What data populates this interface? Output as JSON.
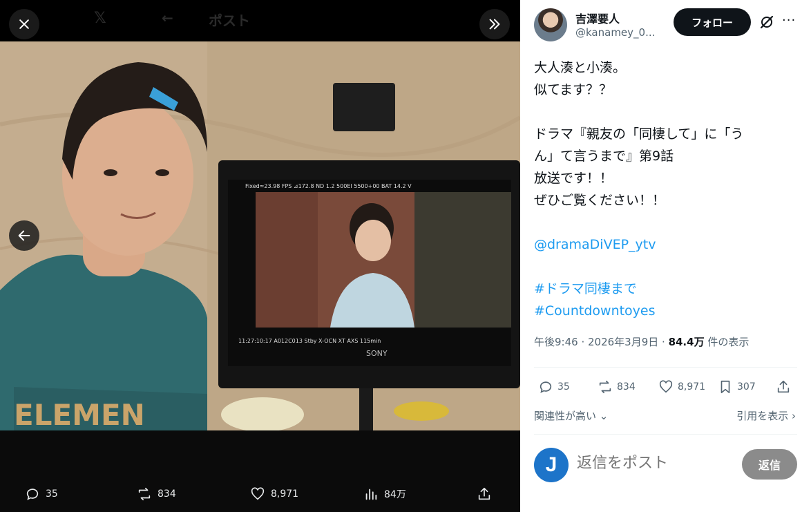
{
  "media": {
    "header_title": "ポスト",
    "actions": {
      "reply_count": "35",
      "repost_count": "834",
      "like_count": "8,971",
      "views_count": "84万"
    },
    "photo": {
      "monitor_brand": "SONY",
      "monitor_top": [
        "Fixed≈23.98 FPS",
        "⊿172.8",
        "ND 1.2",
        "500EI",
        "5500+00",
        "BAT 14.2 V"
      ],
      "monitor_bottom": [
        "11:27:10:17",
        "A012C013",
        "Stby",
        "X-OCN XT",
        "AXS 115min"
      ],
      "shirt_text": "ELEMEN"
    }
  },
  "author": {
    "name": "吉澤要人",
    "handle": "@kanamey_0..."
  },
  "buttons": {
    "follow": "フォロー",
    "reply": "返信"
  },
  "tweet": {
    "line1": "大人湊と小湊。",
    "line2": "似てます？？",
    "line3": "ドラマ『親友の「同棲して」に「う",
    "line4": "ん」て言うまで』第9話",
    "line5": "放送です！！",
    "line6": "ぜひご覧ください！！",
    "mention": "@dramaDiVEP_ytv",
    "hashtag1": "#ドラマ同棲まで",
    "hashtag2": "#Countdowntoyes"
  },
  "meta": {
    "time": "午後9:46 · 2026年3月9日 · ",
    "views": "84.4万",
    "views_suffix": " 件の表示"
  },
  "stats": {
    "replies": "35",
    "reposts": "834",
    "likes": "8,971",
    "bookmarks": "307"
  },
  "sort_label": "関連性が高い",
  "quote_label": "引用を表示",
  "reply_placeholder": "返信をポスト",
  "reply_avatar_letter": "J"
}
